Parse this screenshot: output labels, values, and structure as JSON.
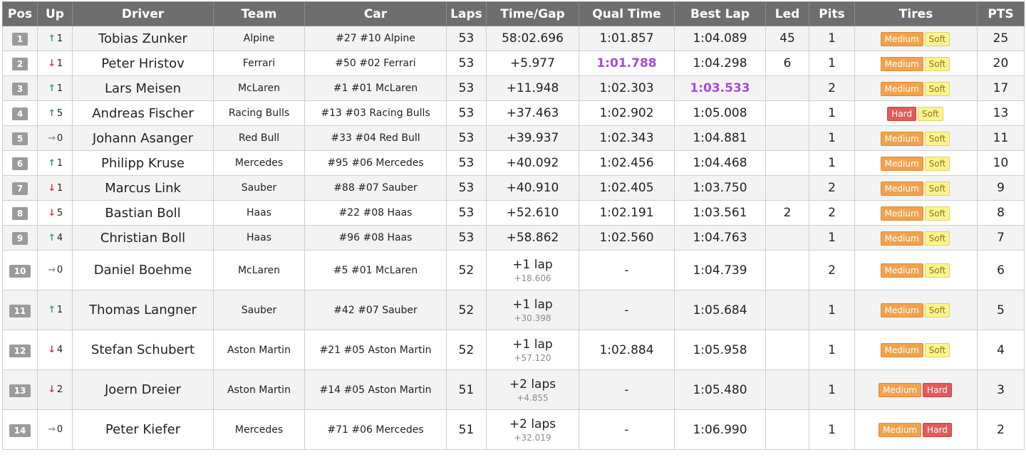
{
  "headers": [
    "Pos",
    "Up",
    "Driver",
    "Team",
    "Car",
    "Laps",
    "Time/Gap",
    "Qual Time",
    "Best Lap",
    "Led",
    "Pits",
    "Tires",
    "PTS"
  ],
  "rows": [
    {
      "pos": "1",
      "dir": "up",
      "delta": "1",
      "driver": "Tobias Zunker",
      "team": "Alpine",
      "car": "#27 #10 Alpine",
      "laps": "53",
      "gap": "58:02.696",
      "gap_sub": "",
      "qual": "1:01.857",
      "qual_best": false,
      "best": "1:04.089",
      "best_best": false,
      "led": "45",
      "pits": "1",
      "tires": [
        "Medium",
        "Soft"
      ],
      "pts": "25"
    },
    {
      "pos": "2",
      "dir": "down",
      "delta": "1",
      "driver": "Peter Hristov",
      "team": "Ferrari",
      "car": "#50 #02 Ferrari",
      "laps": "53",
      "gap": "+5.977",
      "gap_sub": "",
      "qual": "1:01.788",
      "qual_best": true,
      "best": "1:04.298",
      "best_best": false,
      "led": "6",
      "pits": "1",
      "tires": [
        "Medium",
        "Soft"
      ],
      "pts": "20"
    },
    {
      "pos": "3",
      "dir": "up",
      "delta": "1",
      "driver": "Lars Meisen",
      "team": "McLaren",
      "car": "#1 #01 McLaren",
      "laps": "53",
      "gap": "+11.948",
      "gap_sub": "",
      "qual": "1:02.303",
      "qual_best": false,
      "best": "1:03.533",
      "best_best": true,
      "led": "",
      "pits": "2",
      "tires": [
        "Medium",
        "Soft"
      ],
      "pts": "17"
    },
    {
      "pos": "4",
      "dir": "up",
      "delta": "5",
      "driver": "Andreas Fischer",
      "team": "Racing Bulls",
      "car": "#13 #03 Racing Bulls",
      "laps": "53",
      "gap": "+37.463",
      "gap_sub": "",
      "qual": "1:02.902",
      "qual_best": false,
      "best": "1:05.008",
      "best_best": false,
      "led": "",
      "pits": "1",
      "tires": [
        "Hard",
        "Soft"
      ],
      "pts": "13"
    },
    {
      "pos": "5",
      "dir": "none",
      "delta": "0",
      "driver": "Johann Asanger",
      "team": "Red Bull",
      "car": "#33 #04 Red Bull",
      "laps": "53",
      "gap": "+39.937",
      "gap_sub": "",
      "qual": "1:02.343",
      "qual_best": false,
      "best": "1:04.881",
      "best_best": false,
      "led": "",
      "pits": "1",
      "tires": [
        "Medium",
        "Soft"
      ],
      "pts": "11"
    },
    {
      "pos": "6",
      "dir": "up",
      "delta": "1",
      "driver": "Philipp Kruse",
      "team": "Mercedes",
      "car": "#95 #06 Mercedes",
      "laps": "53",
      "gap": "+40.092",
      "gap_sub": "",
      "qual": "1:02.456",
      "qual_best": false,
      "best": "1:04.468",
      "best_best": false,
      "led": "",
      "pits": "1",
      "tires": [
        "Medium",
        "Soft"
      ],
      "pts": "10"
    },
    {
      "pos": "7",
      "dir": "down",
      "delta": "1",
      "driver": "Marcus Link",
      "team": "Sauber",
      "car": "#88 #07 Sauber",
      "laps": "53",
      "gap": "+40.910",
      "gap_sub": "",
      "qual": "1:02.405",
      "qual_best": false,
      "best": "1:03.750",
      "best_best": false,
      "led": "",
      "pits": "2",
      "tires": [
        "Medium",
        "Soft"
      ],
      "pts": "9"
    },
    {
      "pos": "8",
      "dir": "down",
      "delta": "5",
      "driver": "Bastian Boll",
      "team": "Haas",
      "car": "#22 #08 Haas",
      "laps": "53",
      "gap": "+52.610",
      "gap_sub": "",
      "qual": "1:02.191",
      "qual_best": false,
      "best": "1:03.561",
      "best_best": false,
      "led": "2",
      "pits": "2",
      "tires": [
        "Medium",
        "Soft"
      ],
      "pts": "8"
    },
    {
      "pos": "9",
      "dir": "up",
      "delta": "4",
      "driver": "Christian Boll",
      "team": "Haas",
      "car": "#96 #08 Haas",
      "laps": "53",
      "gap": "+58.862",
      "gap_sub": "",
      "qual": "1:02.560",
      "qual_best": false,
      "best": "1:04.763",
      "best_best": false,
      "led": "",
      "pits": "1",
      "tires": [
        "Medium",
        "Soft"
      ],
      "pts": "7"
    },
    {
      "pos": "10",
      "dir": "none",
      "delta": "0",
      "driver": "Daniel Boehme",
      "team": "McLaren",
      "car": "#5 #01 McLaren",
      "laps": "52",
      "gap": "+1 lap",
      "gap_sub": "+18.606",
      "qual": "-",
      "qual_best": false,
      "best": "1:04.739",
      "best_best": false,
      "led": "",
      "pits": "2",
      "tires": [
        "Medium",
        "Soft"
      ],
      "pts": "6"
    },
    {
      "pos": "11",
      "dir": "up",
      "delta": "1",
      "driver": "Thomas Langner",
      "team": "Sauber",
      "car": "#42 #07 Sauber",
      "laps": "52",
      "gap": "+1 lap",
      "gap_sub": "+30.398",
      "qual": "-",
      "qual_best": false,
      "best": "1:05.684",
      "best_best": false,
      "led": "",
      "pits": "1",
      "tires": [
        "Medium",
        "Soft"
      ],
      "pts": "5"
    },
    {
      "pos": "12",
      "dir": "down",
      "delta": "4",
      "driver": "Stefan Schubert",
      "team": "Aston Martin",
      "car": "#21 #05 Aston Martin",
      "laps": "52",
      "gap": "+1 lap",
      "gap_sub": "+57.120",
      "qual": "1:02.884",
      "qual_best": false,
      "best": "1:05.958",
      "best_best": false,
      "led": "",
      "pits": "1",
      "tires": [
        "Medium",
        "Soft"
      ],
      "pts": "4"
    },
    {
      "pos": "13",
      "dir": "down",
      "delta": "2",
      "driver": "Joern Dreier",
      "team": "Aston Martin",
      "car": "#14 #05 Aston Martin",
      "laps": "51",
      "gap": "+2 laps",
      "gap_sub": "+4.855",
      "qual": "-",
      "qual_best": false,
      "best": "1:05.480",
      "best_best": false,
      "led": "",
      "pits": "1",
      "tires": [
        "Medium",
        "Hard"
      ],
      "pts": "3"
    },
    {
      "pos": "14",
      "dir": "none",
      "delta": "0",
      "driver": "Peter Kiefer",
      "team": "Mercedes",
      "car": "#71 #06 Mercedes",
      "laps": "51",
      "gap": "+2 laps",
      "gap_sub": "+32.019",
      "qual": "-",
      "qual_best": false,
      "best": "1:06.990",
      "best_best": false,
      "led": "",
      "pits": "1",
      "tires": [
        "Medium",
        "Hard"
      ],
      "pts": "2"
    }
  ],
  "colors": {
    "header_bg": "#6e6e6e",
    "best_time": "#a64bd8",
    "arrow_up": "#36a852",
    "arrow_down": "#d23b3b",
    "arrow_none": "#9a9a9a",
    "tire_medium": "#f2a24c",
    "tire_soft": "#fdf38e",
    "tire_hard": "#e35a5a"
  },
  "icons": {
    "up": "arrow-up-icon",
    "down": "arrow-down-icon",
    "none": "arrow-right-icon"
  }
}
